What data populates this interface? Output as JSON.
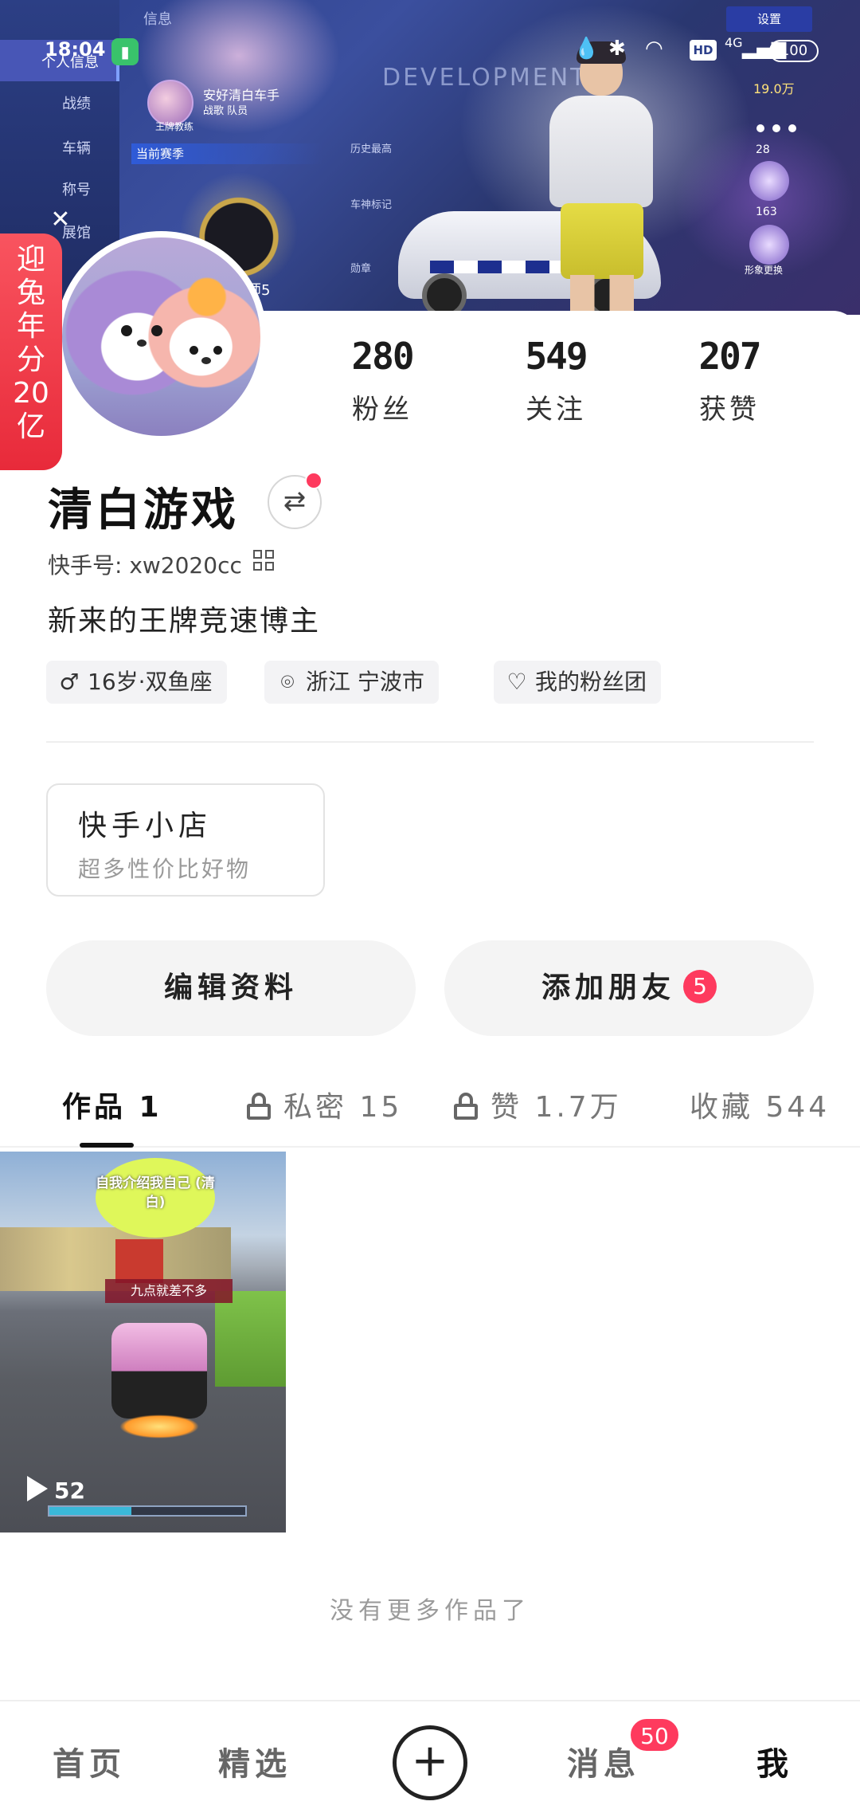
{
  "status_bar": {
    "time": "18:04",
    "battery": "100",
    "network": "4G",
    "hd": "HD"
  },
  "cover": {
    "sidebar_items": [
      "个人信息",
      "战绩",
      "车辆",
      "称号",
      "展馆"
    ],
    "info_tab": "信息",
    "season": "当前赛季",
    "player_name": "安好清白车手",
    "player_team": "战歌 队员",
    "player_rank": "王牌教练",
    "watermark": "DEVELOPMENT",
    "history_label": "历史最高",
    "car_mark": "车神标记",
    "medal": "勋章",
    "badge_level": "师5",
    "settings": "设置",
    "score": "19.0万",
    "side_counts": [
      "28",
      "163"
    ],
    "avatar_change": "形象更换"
  },
  "promo": {
    "text_chars": [
      "迎",
      "兔",
      "年",
      "分",
      "20",
      "亿"
    ]
  },
  "profile": {
    "stats": [
      {
        "value": "280",
        "label": "粉丝"
      },
      {
        "value": "549",
        "label": "关注"
      },
      {
        "value": "207",
        "label": "获赞"
      }
    ],
    "name": "清白游戏",
    "kuaishou_id": "快手号: xw2020cc",
    "bio": "新来的王牌竞速博主",
    "tags": [
      {
        "icon": "male-icon",
        "text": "16岁·双鱼座"
      },
      {
        "icon": "location-icon",
        "text": "浙江 宁波市"
      },
      {
        "icon": "heart-icon",
        "text": "我的粉丝团"
      }
    ]
  },
  "shop": {
    "title": "快手小店",
    "subtitle": "超多性价比好物"
  },
  "actions": {
    "edit_profile": "编辑资料",
    "add_friend": "添加朋友",
    "add_friend_badge": "5"
  },
  "tabs": [
    {
      "label": "作品 1",
      "locked": false,
      "active": true
    },
    {
      "label": "私密 15",
      "locked": true,
      "active": false
    },
    {
      "label": "赞 1.7万",
      "locked": true,
      "active": false
    },
    {
      "label": "收藏 544",
      "locked": false,
      "active": false
    }
  ],
  "works": [
    {
      "caption_bubble": "自我介绍我自己 (清白)",
      "overlay_banner": "九点就差不多",
      "play_count": "52",
      "progress": 0.42
    }
  ],
  "no_more_text": "没有更多作品了",
  "bottom_nav": {
    "items": [
      "首页",
      "精选",
      "消息",
      "我"
    ],
    "messages_badge": "50",
    "active": "我"
  }
}
